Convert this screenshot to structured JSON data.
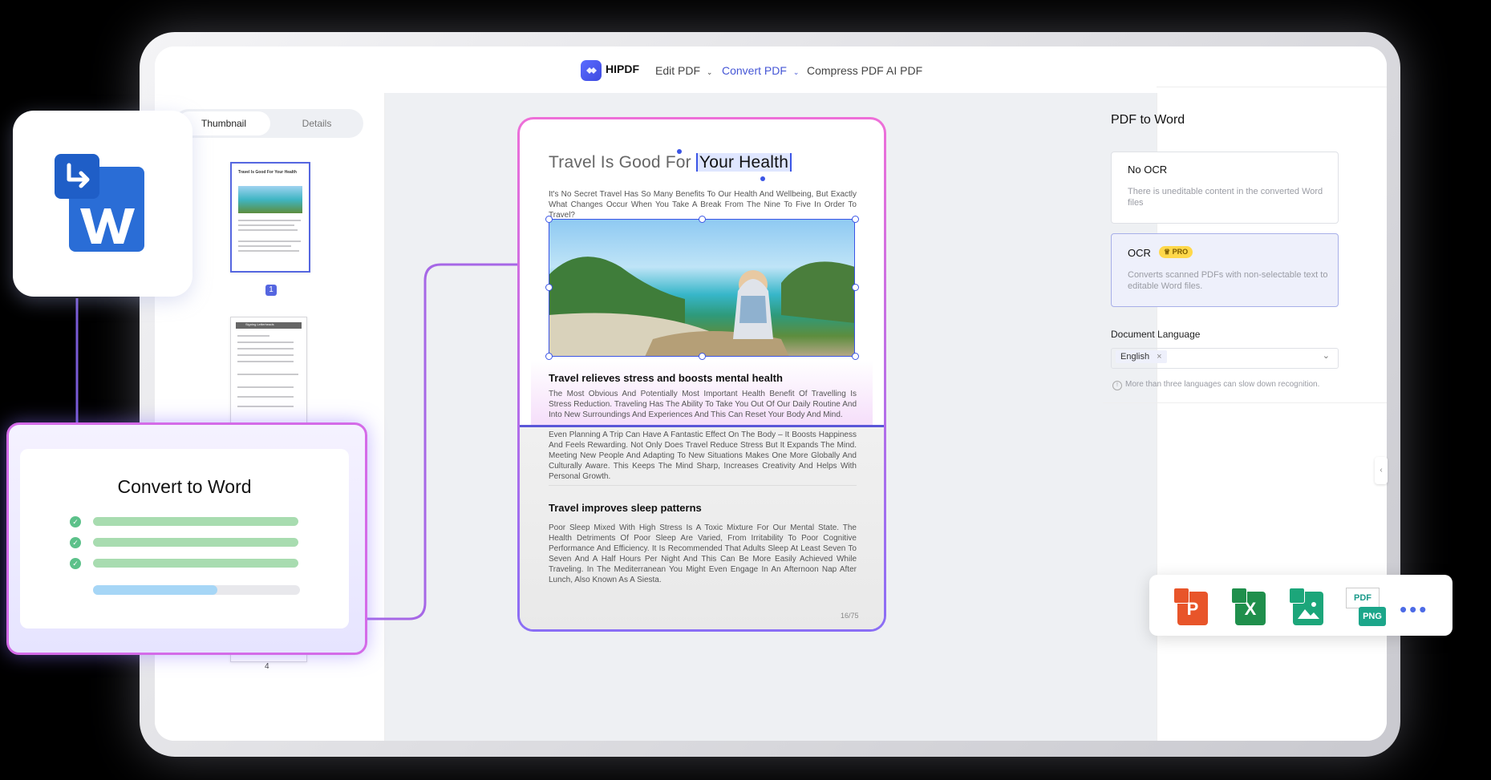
{
  "nav": {
    "brand": "HIPDF",
    "items": [
      "Edit PDF",
      "Convert PDF",
      "Compress PDF",
      "AI PDF"
    ],
    "active": "Convert PDF"
  },
  "left_panel": {
    "tabs": [
      "Thumbnail",
      "Details"
    ],
    "thumb_title": "Travel Is Good For Your Health",
    "thumb2_title": "Signing Letterheads",
    "selected_page": "1",
    "last_page": "4"
  },
  "document": {
    "title_plain": "Travel Is Good For ",
    "title_highlight": "Your Health",
    "intro": "It's No Secret Travel Has So Many Benefits To Our Health And Wellbeing, But Exactly What Changes Occur When You Take A Break From The Nine To Five In Order To Travel?",
    "section1_heading": "Travel relieves stress and boosts mental health",
    "section1_p1": "The Most Obvious And Potentially Most Important Health Benefit Of Travelling Is Stress Reduction. Traveling Has The Ability To Take You Out Of Our Daily Routine And Into New Surroundings And Experiences And This Can Reset Your Body And Mind.",
    "section1_p2": "Even Planning A Trip Can Have A Fantastic Effect On The Body – It Boosts Happiness And Feels Rewarding. Not Only Does Travel Reduce Stress But It Expands The Mind. Meeting New People And Adapting To New Situations Makes One More Globally And Culturally Aware. This Keeps The Mind Sharp, Increases Creativity And Helps With Personal Growth.",
    "section2_heading": "Travel improves sleep patterns",
    "section2_p": "Poor Sleep Mixed With High Stress Is A Toxic Mixture For Our Mental State. The Health Detriments Of Poor Sleep Are Varied, From Irritability To Poor Cognitive Performance And Efficiency. It Is Recommended That Adults Sleep At Least Seven To Seven And A Half Hours Per Night And This Can Be More Easily Achieved While Traveling. In The Mediterranean You Might Even Engage In An Afternoon Nap After Lunch, Also Known As A Siesta.",
    "page_number": "16/75"
  },
  "right_panel": {
    "title": "PDF to Word",
    "options": [
      {
        "title": "No OCR",
        "desc": "There is uneditable content in the converted Word files",
        "selected": false
      },
      {
        "title": "OCR",
        "badge": "PRO",
        "desc": "Converts scanned PDFs with non-selectable text to editable Word files.",
        "selected": true
      }
    ],
    "language_label": "Document Language",
    "language_value": "English",
    "language_note": "More than three languages can slow down recognition."
  },
  "convert_card": {
    "title": "Convert to Word",
    "steps_done": 3,
    "progress": 0.6
  },
  "format_icons": {
    "items": [
      "ppt-icon",
      "excel-icon",
      "image-icon",
      "png-icon"
    ],
    "pdf_png_label_top": "PDF",
    "pdf_png_label_bottom": "PNG",
    "more": "•••"
  },
  "colors": {
    "accent": "#4657d6",
    "word_blue": "#2a6dd6",
    "ppt": "#e8552a",
    "excel": "#1f8f4c",
    "image": "#1ca67a",
    "pro_badge": "#ffd84a"
  }
}
